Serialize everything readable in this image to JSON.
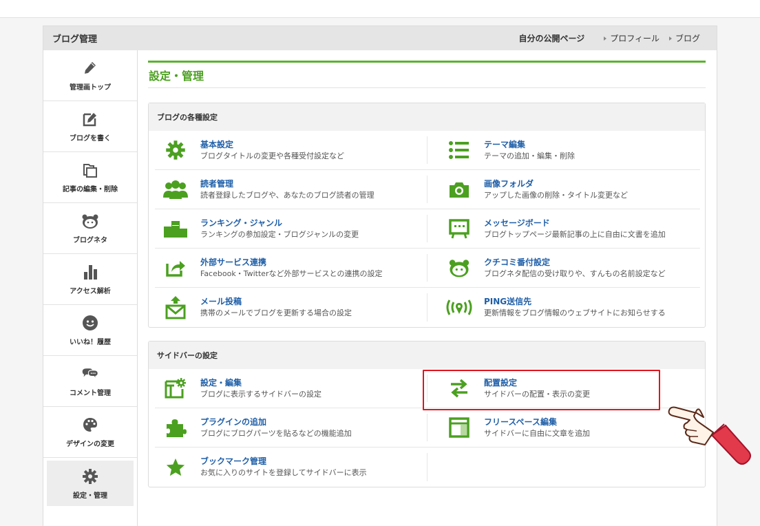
{
  "header": {
    "title": "ブログ管理",
    "my_public_page": "自分の公開ページ",
    "profile_link": "プロフィール",
    "blog_link": "ブログ"
  },
  "sidebar": {
    "items": [
      {
        "label": "管理画トップ",
        "icon": "pencil-icon"
      },
      {
        "label": "ブログを書く",
        "icon": "edit-icon"
      },
      {
        "label": "記事の編集・削除",
        "icon": "documents-icon"
      },
      {
        "label": "ブログネタ",
        "icon": "mascot-icon"
      },
      {
        "label": "アクセス解析",
        "icon": "bar-chart-icon"
      },
      {
        "label": "いいね！履歴",
        "icon": "smiley-icon"
      },
      {
        "label": "コメント管理",
        "icon": "comment-bubbles-icon"
      },
      {
        "label": "デザインの変更",
        "icon": "palette-icon"
      },
      {
        "label": "設定・管理",
        "icon": "gear-icon",
        "active": true
      }
    ]
  },
  "main": {
    "title": "設定・管理",
    "blog_settings": {
      "heading": "ブログの各種設定",
      "items": [
        {
          "title": "基本設定",
          "desc": "ブログタイトルの変更や各種受付設定など",
          "icon": "gear-icon"
        },
        {
          "title": "テーマ編集",
          "desc": "テーマの追加・編集・削除",
          "icon": "list-icon"
        },
        {
          "title": "読者管理",
          "desc": "読者登録したブログや、あなたのブログ読者の管理",
          "icon": "users-icon"
        },
        {
          "title": "画像フォルダ",
          "desc": "アップした画像の削除・タイトル変更など",
          "icon": "camera-icon"
        },
        {
          "title": "ランキング・ジャンル",
          "desc": "ランキングの参加設定・ブログジャンルの変更",
          "icon": "podium-icon"
        },
        {
          "title": "メッセージボード",
          "desc": "ブログトップページ最新記事の上に自由に文書を追加",
          "icon": "message-board-icon"
        },
        {
          "title": "外部サービス連携",
          "desc": "Facebook・Twitterなど外部サービスとの連携の設定",
          "icon": "share-icon"
        },
        {
          "title": "クチコミ番付設定",
          "desc": "ブログネタ配信の受け取りや、すんもの名前設定など",
          "icon": "mascot-icon"
        },
        {
          "title": "メール投稿",
          "desc": "携帯のメールでブログを更新する場合の設定",
          "icon": "mail-upload-icon"
        },
        {
          "title": "PING送信先",
          "desc": "更新情報をブログ情報のウェブサイトにお知らせする",
          "icon": "broadcast-icon"
        }
      ]
    },
    "sidebar_settings": {
      "heading": "サイドバーの設定",
      "items": [
        {
          "title": "設定・編集",
          "desc": "ブログに表示するサイドバーの設定",
          "icon": "layout-gear-icon"
        },
        {
          "title": "配置設定",
          "desc": "サイドバーの配置・表示の変更",
          "icon": "swap-arrows-icon"
        },
        {
          "title": "プラグインの追加",
          "desc": "ブログにブログパーツを貼るなどの機能追加",
          "icon": "puzzle-icon"
        },
        {
          "title": "フリースペース編集",
          "desc": "サイドバーに自由に文章を追加",
          "icon": "free-space-icon"
        },
        {
          "title": "ブックマーク管理",
          "desc": "お気に入りのサイトを登録してサイドバーに表示",
          "icon": "star-icon"
        }
      ]
    }
  },
  "colors": {
    "accent_green": "#4ba020",
    "link_blue": "#1f5fa8",
    "highlight_red": "#e0141e",
    "icon_gray": "#555555"
  }
}
